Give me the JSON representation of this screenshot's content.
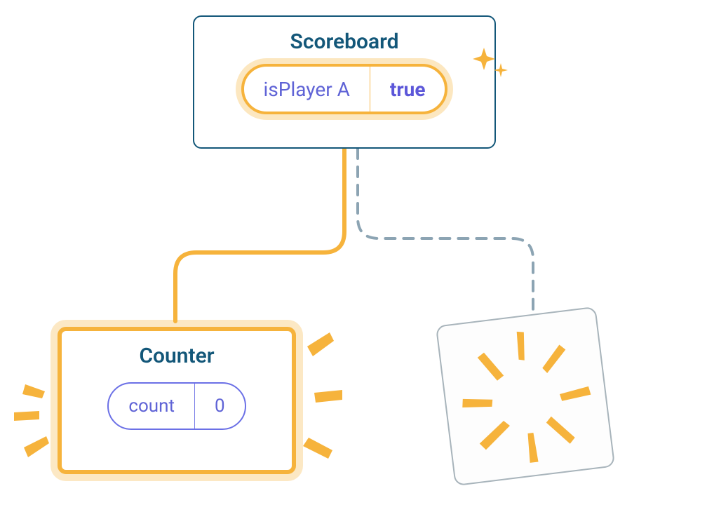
{
  "scoreboard": {
    "title": "Scoreboard",
    "state_label": "isPlayer A",
    "state_value": "true"
  },
  "counter": {
    "title": "Counter",
    "state_label": "count",
    "state_value": "0"
  },
  "colors": {
    "accent": "#F6B33C",
    "outline": "#135779",
    "prop": "#5F63D6",
    "dashed": "#8CA4B3"
  }
}
